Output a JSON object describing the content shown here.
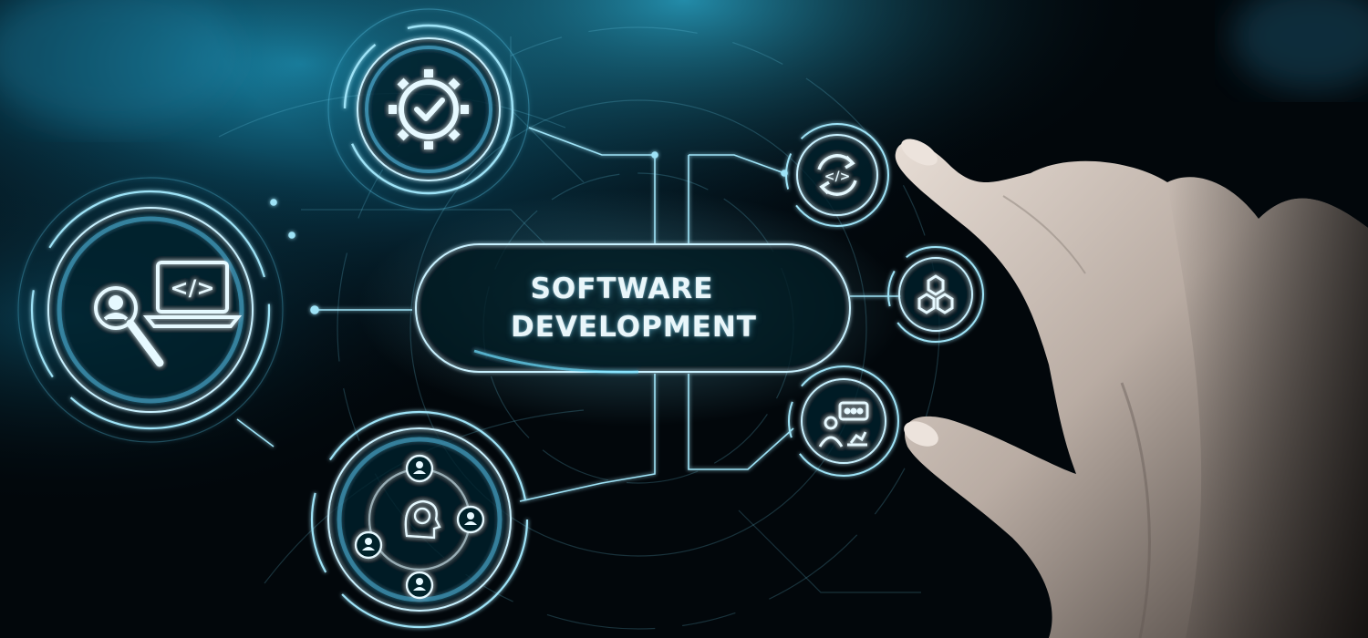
{
  "center": {
    "line1": "SOFTWARE",
    "line2": "DEVELOPMENT"
  },
  "icons": [
    {
      "name": "gear-check-icon"
    },
    {
      "name": "laptop-code-search-icon"
    },
    {
      "name": "team-network-icon"
    },
    {
      "name": "code-sync-icon"
    },
    {
      "name": "hexagon-cluster-icon"
    },
    {
      "name": "presentation-user-icon"
    }
  ],
  "colors": {
    "background": "#02070b",
    "glow": "#5fd4ff",
    "line": "#8fdcf4",
    "hand": "#d9cfc7"
  },
  "laptop_glyph": "</>",
  "sync_glyph": "</>"
}
